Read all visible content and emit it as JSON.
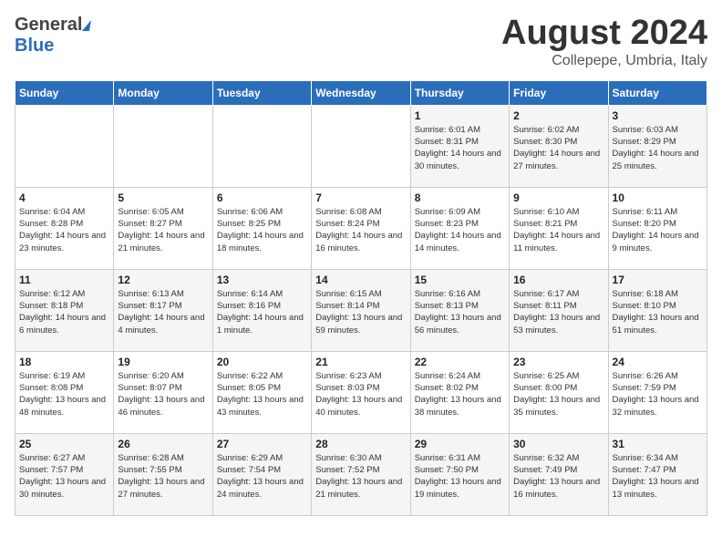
{
  "header": {
    "logo_general": "General",
    "logo_blue": "Blue",
    "month_title": "August 2024",
    "subtitle": "Collepepe, Umbria, Italy"
  },
  "weekdays": [
    "Sunday",
    "Monday",
    "Tuesday",
    "Wednesday",
    "Thursday",
    "Friday",
    "Saturday"
  ],
  "weeks": [
    [
      {
        "day": "",
        "info": ""
      },
      {
        "day": "",
        "info": ""
      },
      {
        "day": "",
        "info": ""
      },
      {
        "day": "",
        "info": ""
      },
      {
        "day": "1",
        "info": "Sunrise: 6:01 AM\nSunset: 8:31 PM\nDaylight: 14 hours\nand 30 minutes."
      },
      {
        "day": "2",
        "info": "Sunrise: 6:02 AM\nSunset: 8:30 PM\nDaylight: 14 hours\nand 27 minutes."
      },
      {
        "day": "3",
        "info": "Sunrise: 6:03 AM\nSunset: 8:29 PM\nDaylight: 14 hours\nand 25 minutes."
      }
    ],
    [
      {
        "day": "4",
        "info": "Sunrise: 6:04 AM\nSunset: 8:28 PM\nDaylight: 14 hours\nand 23 minutes."
      },
      {
        "day": "5",
        "info": "Sunrise: 6:05 AM\nSunset: 8:27 PM\nDaylight: 14 hours\nand 21 minutes."
      },
      {
        "day": "6",
        "info": "Sunrise: 6:06 AM\nSunset: 8:25 PM\nDaylight: 14 hours\nand 18 minutes."
      },
      {
        "day": "7",
        "info": "Sunrise: 6:08 AM\nSunset: 8:24 PM\nDaylight: 14 hours\nand 16 minutes."
      },
      {
        "day": "8",
        "info": "Sunrise: 6:09 AM\nSunset: 8:23 PM\nDaylight: 14 hours\nand 14 minutes."
      },
      {
        "day": "9",
        "info": "Sunrise: 6:10 AM\nSunset: 8:21 PM\nDaylight: 14 hours\nand 11 minutes."
      },
      {
        "day": "10",
        "info": "Sunrise: 6:11 AM\nSunset: 8:20 PM\nDaylight: 14 hours\nand 9 minutes."
      }
    ],
    [
      {
        "day": "11",
        "info": "Sunrise: 6:12 AM\nSunset: 8:18 PM\nDaylight: 14 hours\nand 6 minutes."
      },
      {
        "day": "12",
        "info": "Sunrise: 6:13 AM\nSunset: 8:17 PM\nDaylight: 14 hours\nand 4 minutes."
      },
      {
        "day": "13",
        "info": "Sunrise: 6:14 AM\nSunset: 8:16 PM\nDaylight: 14 hours\nand 1 minute."
      },
      {
        "day": "14",
        "info": "Sunrise: 6:15 AM\nSunset: 8:14 PM\nDaylight: 13 hours\nand 59 minutes."
      },
      {
        "day": "15",
        "info": "Sunrise: 6:16 AM\nSunset: 8:13 PM\nDaylight: 13 hours\nand 56 minutes."
      },
      {
        "day": "16",
        "info": "Sunrise: 6:17 AM\nSunset: 8:11 PM\nDaylight: 13 hours\nand 53 minutes."
      },
      {
        "day": "17",
        "info": "Sunrise: 6:18 AM\nSunset: 8:10 PM\nDaylight: 13 hours\nand 51 minutes."
      }
    ],
    [
      {
        "day": "18",
        "info": "Sunrise: 6:19 AM\nSunset: 8:08 PM\nDaylight: 13 hours\nand 48 minutes."
      },
      {
        "day": "19",
        "info": "Sunrise: 6:20 AM\nSunset: 8:07 PM\nDaylight: 13 hours\nand 46 minutes."
      },
      {
        "day": "20",
        "info": "Sunrise: 6:22 AM\nSunset: 8:05 PM\nDaylight: 13 hours\nand 43 minutes."
      },
      {
        "day": "21",
        "info": "Sunrise: 6:23 AM\nSunset: 8:03 PM\nDaylight: 13 hours\nand 40 minutes."
      },
      {
        "day": "22",
        "info": "Sunrise: 6:24 AM\nSunset: 8:02 PM\nDaylight: 13 hours\nand 38 minutes."
      },
      {
        "day": "23",
        "info": "Sunrise: 6:25 AM\nSunset: 8:00 PM\nDaylight: 13 hours\nand 35 minutes."
      },
      {
        "day": "24",
        "info": "Sunrise: 6:26 AM\nSunset: 7:59 PM\nDaylight: 13 hours\nand 32 minutes."
      }
    ],
    [
      {
        "day": "25",
        "info": "Sunrise: 6:27 AM\nSunset: 7:57 PM\nDaylight: 13 hours\nand 30 minutes."
      },
      {
        "day": "26",
        "info": "Sunrise: 6:28 AM\nSunset: 7:55 PM\nDaylight: 13 hours\nand 27 minutes."
      },
      {
        "day": "27",
        "info": "Sunrise: 6:29 AM\nSunset: 7:54 PM\nDaylight: 13 hours\nand 24 minutes."
      },
      {
        "day": "28",
        "info": "Sunrise: 6:30 AM\nSunset: 7:52 PM\nDaylight: 13 hours\nand 21 minutes."
      },
      {
        "day": "29",
        "info": "Sunrise: 6:31 AM\nSunset: 7:50 PM\nDaylight: 13 hours\nand 19 minutes."
      },
      {
        "day": "30",
        "info": "Sunrise: 6:32 AM\nSunset: 7:49 PM\nDaylight: 13 hours\nand 16 minutes."
      },
      {
        "day": "31",
        "info": "Sunrise: 6:34 AM\nSunset: 7:47 PM\nDaylight: 13 hours\nand 13 minutes."
      }
    ]
  ]
}
